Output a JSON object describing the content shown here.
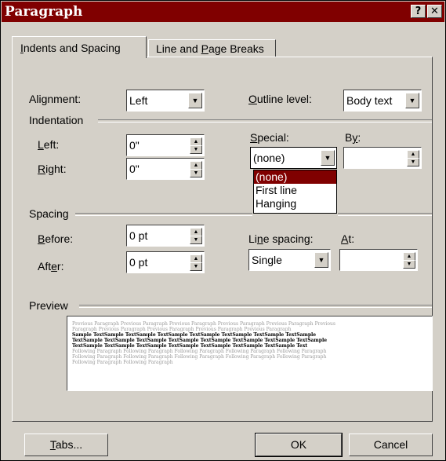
{
  "window": {
    "title": "Paragraph",
    "help_btn": "?",
    "close_btn": "✕"
  },
  "tabs": [
    {
      "label_pre": "",
      "label_u": "I",
      "label_post": "ndents and Spacing"
    },
    {
      "label_pre": "Line and ",
      "label_u": "P",
      "label_post": "age Breaks"
    }
  ],
  "alignment": {
    "label_pre": "Ali",
    "label_u": "g",
    "label_post": "nment:",
    "value": "Left"
  },
  "outline_level": {
    "label_pre": "",
    "label_u": "O",
    "label_post": "utline level:",
    "value": "Body text"
  },
  "indentation": {
    "group_label": "Indentation",
    "left": {
      "label_pre": "",
      "label_u": "L",
      "label_post": "eft:",
      "value": "0\""
    },
    "right": {
      "label_pre": "",
      "label_u": "R",
      "label_post": "ight:",
      "value": "0\""
    },
    "special": {
      "label_pre": "",
      "label_u": "S",
      "label_post": "pecial:",
      "value": "(none)"
    },
    "by": {
      "label_pre": "B",
      "label_u": "y",
      "label_post": ":",
      "value": ""
    },
    "special_options": [
      "(none)",
      "First line",
      "Hanging"
    ]
  },
  "spacing": {
    "group_label": "Spacing",
    "before": {
      "label_pre": "",
      "label_u": "B",
      "label_post": "efore:",
      "value": "0 pt"
    },
    "after": {
      "label_pre": "Aft",
      "label_u": "e",
      "label_post": "r:",
      "value": "0 pt"
    },
    "line_spacing": {
      "label_pre": "Li",
      "label_u": "n",
      "label_post": "e spacing:",
      "value": "Single"
    },
    "at": {
      "label_pre": "",
      "label_u": "A",
      "label_post": "t:",
      "value": ""
    }
  },
  "preview": {
    "group_label": "Preview",
    "prev_lines": [
      "Previous Paragraph Previous Paragraph Previous Paragraph Previous Paragraph Previous Paragraph Previous",
      "Paragraph Previous Paragraph Previous Paragraph Previous Paragraph Previous Paragraph"
    ],
    "sample_lines": [
      "Sample TextSample TextSample TextSample TextSample TextSample TextSample TextSample",
      "TextSample TextSample TextSample TextSample TextSample TextSample TextSample TextSample",
      "TextSample TextSample TextSample TextSample TextSample TextSample TextSample Text"
    ],
    "follow_lines": [
      "Following Paragraph Following Paragraph Following Paragraph Following Paragraph Following Paragraph",
      "Following Paragraph Following Paragraph Following Paragraph Following Paragraph Following Paragraph",
      "Following Paragraph Following Paragraph"
    ]
  },
  "buttons": {
    "tabs": {
      "label_pre": "",
      "label_u": "T",
      "label_post": "abs..."
    },
    "ok": "OK",
    "cancel": "Cancel"
  },
  "colors": {
    "title_bg": "#800000",
    "face": "#d4d0c8",
    "selection": "#800000"
  }
}
